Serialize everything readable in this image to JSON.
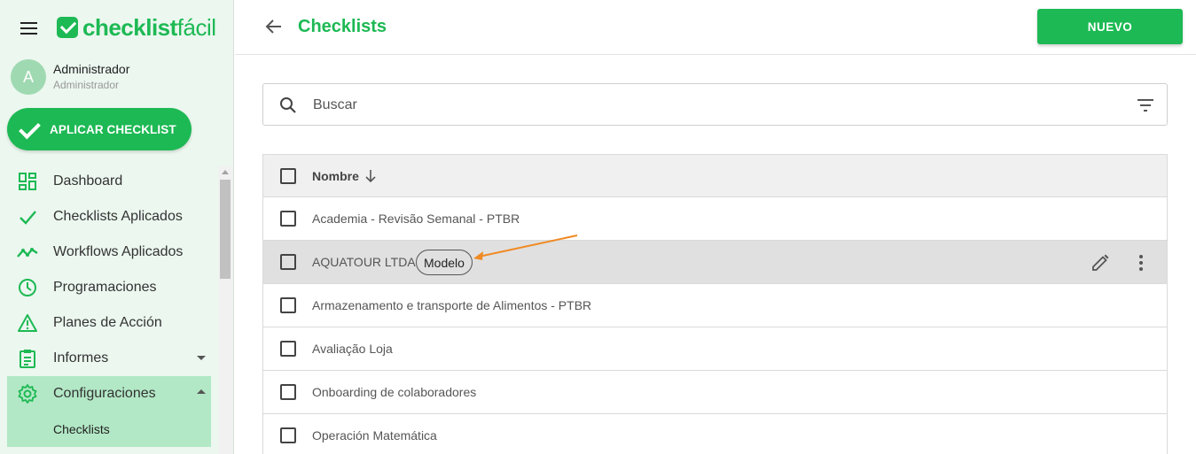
{
  "brand": {
    "logo_bold": "checklist",
    "logo_light": "fácil",
    "accent": "#1db954"
  },
  "user": {
    "initial": "A",
    "name": "Administrador",
    "role": "Administrador"
  },
  "sidebar": {
    "apply_label": "APLICAR CHECKLIST",
    "items": [
      {
        "label": "Dashboard",
        "icon": "dashboard-icon"
      },
      {
        "label": "Checklists Aplicados",
        "icon": "check-icon"
      },
      {
        "label": "Workflows Aplicados",
        "icon": "trending-icon"
      },
      {
        "label": "Programaciones",
        "icon": "clock-icon"
      },
      {
        "label": "Planes de Acción",
        "icon": "warning-icon"
      },
      {
        "label": "Informes",
        "icon": "report-icon"
      },
      {
        "label": "Configuraciones",
        "icon": "gear-icon"
      }
    ],
    "sub_item": "Checklists"
  },
  "header": {
    "title": "Checklists",
    "new_label": "NUEVO"
  },
  "search": {
    "placeholder": "Buscar"
  },
  "table": {
    "column": "Nombre",
    "rows": [
      {
        "name": "Academia - Revisão Semanal - PTBR"
      },
      {
        "name": "AQUATOUR LTDA",
        "badge": "Modelo"
      },
      {
        "name": "Armazenamento e transporte de Alimentos - PTBR"
      },
      {
        "name": "Avaliação Loja"
      },
      {
        "name": "Onboarding de colaboradores"
      },
      {
        "name": "Operación Matemática"
      }
    ]
  }
}
